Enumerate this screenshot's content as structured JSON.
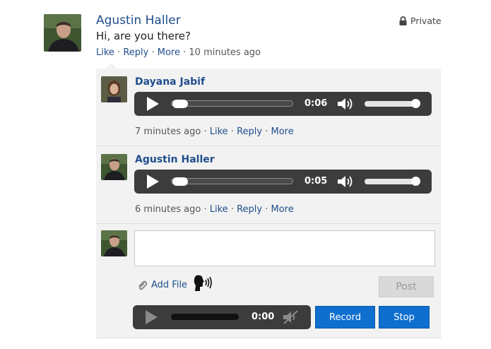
{
  "post": {
    "author": "Agustin Haller",
    "text": "Hi, are you there?",
    "privacy": "Private",
    "actions": {
      "like": "Like",
      "reply": "Reply",
      "more": "More"
    },
    "time": "10 minutes ago"
  },
  "comments": [
    {
      "author": "Dayana Jabif",
      "audio": {
        "time": "0:06",
        "progress": 0.0,
        "volume": 1.0
      },
      "time": "7 minutes ago",
      "actions": {
        "like": "Like",
        "reply": "Reply",
        "more": "More"
      }
    },
    {
      "author": "Agustin Haller",
      "audio": {
        "time": "0:05",
        "progress": 0.0,
        "volume": 1.0
      },
      "time": "6 minutes ago",
      "actions": {
        "like": "Like",
        "reply": "Reply",
        "more": "More"
      }
    }
  ],
  "reply": {
    "textarea_value": "",
    "add_file": "Add File",
    "post": "Post",
    "recorder": {
      "time": "0:00"
    },
    "record": "Record",
    "stop": "Stop"
  },
  "icons": {
    "privacy": "lock-icon",
    "attach": "paperclip-icon",
    "voice": "speaking-head-icon",
    "volume": "speaker-icon",
    "muted": "speaker-muted-icon",
    "play": "play-icon"
  },
  "colors": {
    "link": "#1f4e8c",
    "button": "#0f6fcf",
    "player": "#3c3c3c",
    "panel": "#f2f2f2"
  }
}
